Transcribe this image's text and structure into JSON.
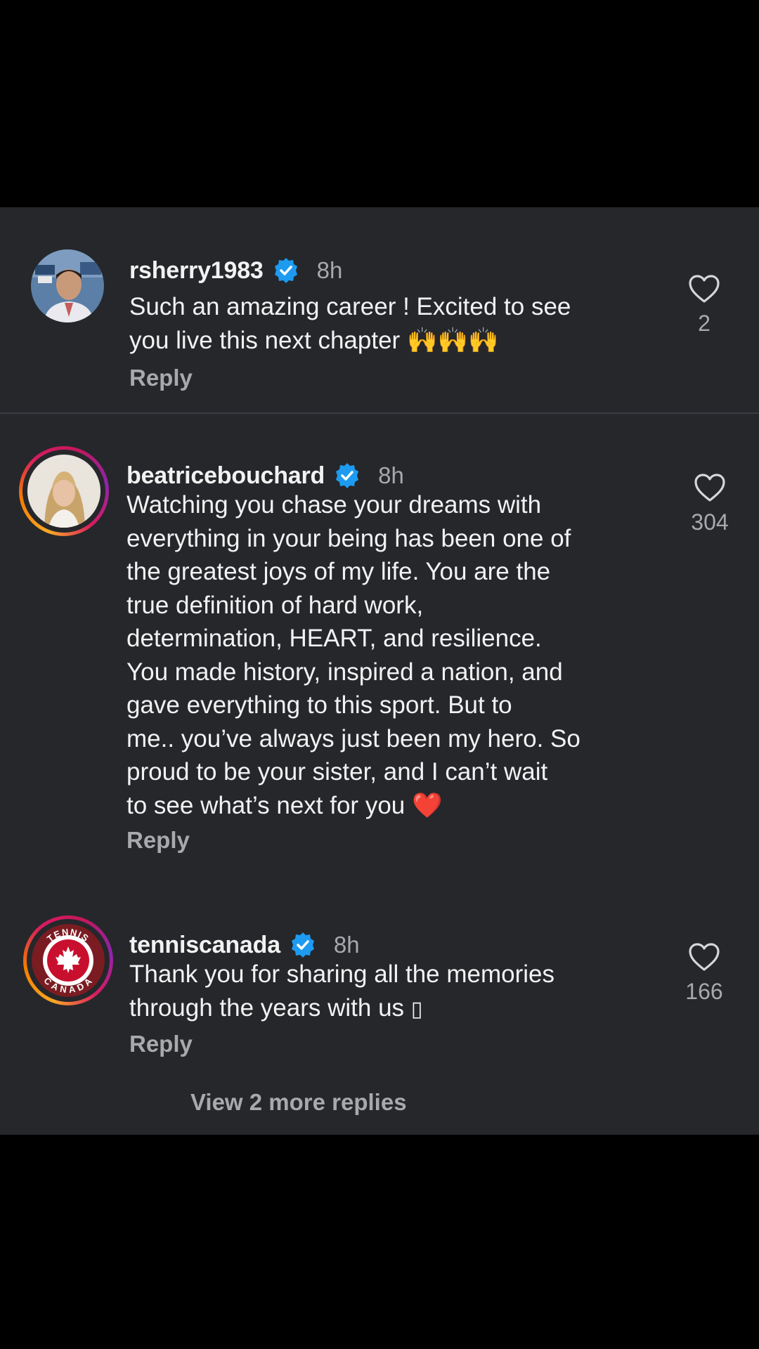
{
  "comments": [
    {
      "username": "rsherry1983",
      "time": "8h",
      "text": "Such an amazing career !  Excited to see\nyou live this next chapter ",
      "emoji": "🙌🙌🙌",
      "reply_label": "Reply",
      "likes": "2"
    },
    {
      "username": "beatricebouchard",
      "time": "8h",
      "text": "Watching you chase your dreams with\neverything in your being has been one of\nthe greatest joys of my life. You are the\ntrue definition of hard work,\ndetermination, HEART, and resilience.\nYou made history, inspired a nation, and\ngave everything to this sport. But to\nme.. you’ve always just been my hero. So\nproud to be your sister, and I can’t wait\nto see what’s next for you ",
      "emoji": "❤️",
      "reply_label": "Reply",
      "likes": "304"
    },
    {
      "username": "tenniscanada",
      "time": "8h",
      "text": "Thank you for sharing all the memories\nthrough the years with us ",
      "emoji": "▯",
      "reply_label": "Reply",
      "likes": "166",
      "logo_top": "TENNIS",
      "logo_bottom": "CANADA"
    }
  ],
  "view_more_replies": "View 2 more replies",
  "colors": {
    "panel_bg": "#25272b",
    "verified_blue": "#1d9bf0",
    "secondary_text": "#a8a8ad",
    "primary_text": "#f2f2f2"
  },
  "icons": [
    "verified-badge-icon",
    "heart-outline-icon"
  ]
}
